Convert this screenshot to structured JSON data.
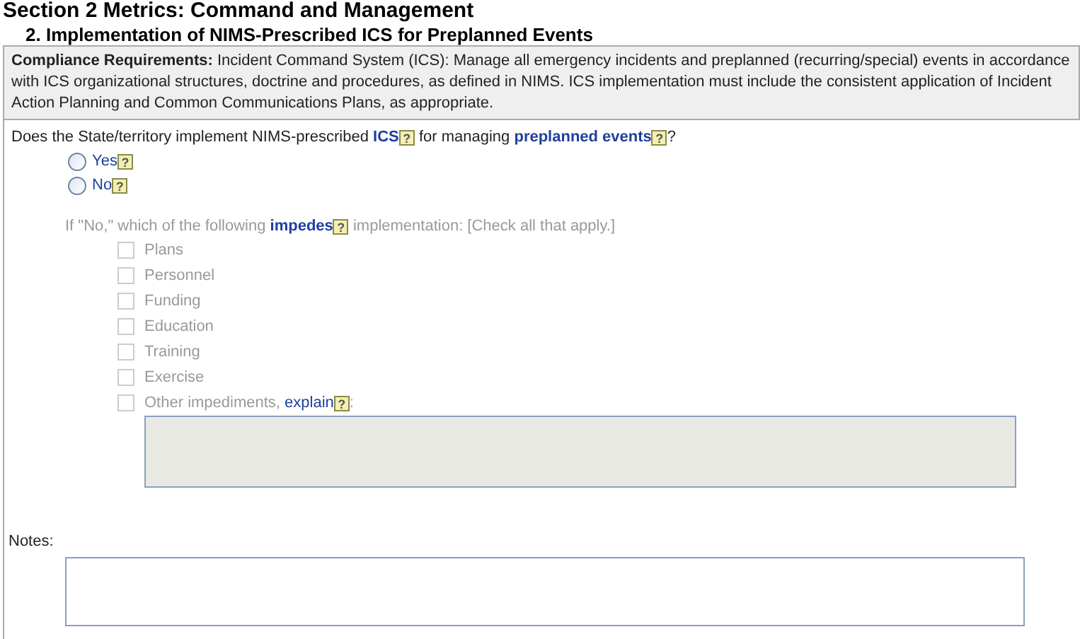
{
  "section_title": "Section 2 Metrics:  Command and Management",
  "subsection_title": "2. Implementation of NIMS-Prescribed ICS for Preplanned Events",
  "compliance": {
    "label": "Compliance Requirements:",
    "text": "Incident Command System (ICS): Manage all emergency incidents and preplanned (recurring/special) events in accordance with ICS organizational structures, doctrine and procedures, as defined in NIMS. ICS implementation must include the consistent application of Incident Action Planning and Common Communications Plans, as appropriate."
  },
  "question": [
    {
      "kind": "text",
      "text": "Does the State/territory implement NIMS-prescribed "
    },
    {
      "kind": "link",
      "text": "ICS",
      "help": "?"
    },
    {
      "kind": "text",
      "text": " for managing "
    },
    {
      "kind": "link",
      "text": "preplanned events",
      "help": "?"
    },
    {
      "kind": "text",
      "text": "?"
    }
  ],
  "answers": [
    {
      "label": "Yes",
      "help": "?",
      "selected": false
    },
    {
      "label": "No",
      "help": "?",
      "selected": false
    }
  ],
  "impediments": {
    "disabled": true,
    "prompt": [
      {
        "kind": "text",
        "text": "If \"No,\" which of the following "
      },
      {
        "kind": "link",
        "text": "impedes",
        "help": "?"
      },
      {
        "kind": "text",
        "text": " implementation: [Check all that apply.]"
      }
    ],
    "options": [
      {
        "label": "Plans",
        "checked": false
      },
      {
        "label": "Personnel",
        "checked": false
      },
      {
        "label": "Funding",
        "checked": false
      },
      {
        "label": "Education",
        "checked": false
      },
      {
        "label": "Training",
        "checked": false
      },
      {
        "label": "Exercise",
        "checked": false
      }
    ],
    "other": {
      "label": "Other impediments, ",
      "link": "explain",
      "help": "?",
      "suffix": ":",
      "checked": false
    }
  },
  "notes": {
    "label": "Notes:"
  }
}
